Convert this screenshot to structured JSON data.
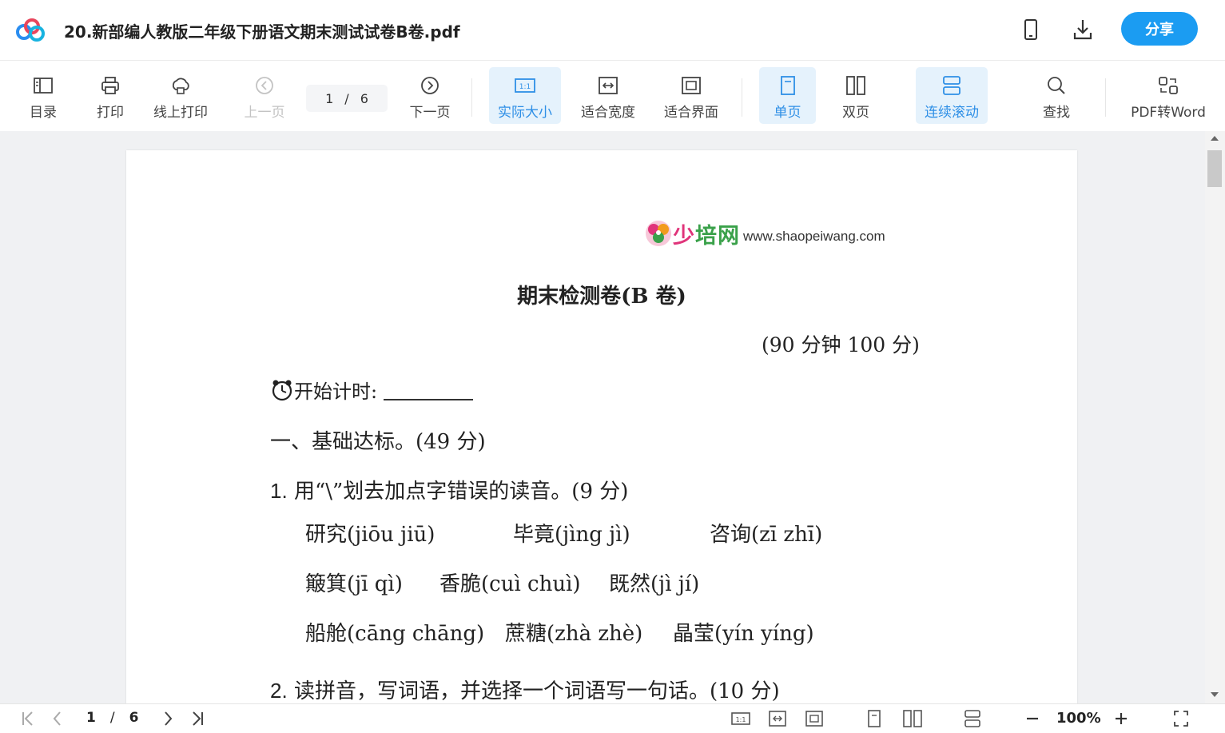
{
  "header": {
    "doc_title": "20.新部编人教版二年级下册语文期末测试试卷B卷.pdf",
    "share_label": "分享"
  },
  "toolbar": {
    "toc": "目录",
    "print": "打印",
    "online_print": "线上打印",
    "prev_page": "上一页",
    "page_current": "1",
    "page_sep": "/",
    "page_total": "6",
    "next_page": "下一页",
    "actual_size": "实际大小",
    "fit_width": "适合宽度",
    "fit_page": "适合界面",
    "single_page": "单页",
    "double_page": "双页",
    "continuous_scroll": "连续滚动",
    "find": "查找",
    "pdf_to_word": "PDF转Word"
  },
  "document": {
    "brand_name_a": "少",
    "brand_name_b": "培网",
    "brand_url": "www.shaopeiwang.com",
    "title": "期末检测卷(B 卷)",
    "meta": "(90 分钟    100 分)",
    "timer_label": "开始计时:",
    "section1": "一、基础达标。(49 分)",
    "q1_num": "1.",
    "q1_text": " 用“\\”划去加点字错误的读音。(9 分)",
    "q1_rows": [
      [
        "研究(jiōu    jiū)",
        "毕竟(jìng    jì)",
        "咨询(zī    zhī)"
      ],
      [
        "簸箕(jī    qì)",
        "香脆(cuì    chuì)",
        "既然(jì    jí)"
      ],
      [
        "船舱(cāng    chāng)",
        "蔗糖(zhà    zhè)",
        "晶莹(yín    yíng)"
      ]
    ],
    "q2_num": "2.",
    "q2_text": " 读拼音，写词语，并选择一个词语写一句话。(10 分)"
  },
  "bottombar": {
    "page_current": "1",
    "page_sep": "/",
    "page_total": "6",
    "zoom": "100%"
  },
  "colors": {
    "accent": "#1b9cf2",
    "active_bg": "#e5f2fc",
    "active_text": "#2e8fe6"
  }
}
